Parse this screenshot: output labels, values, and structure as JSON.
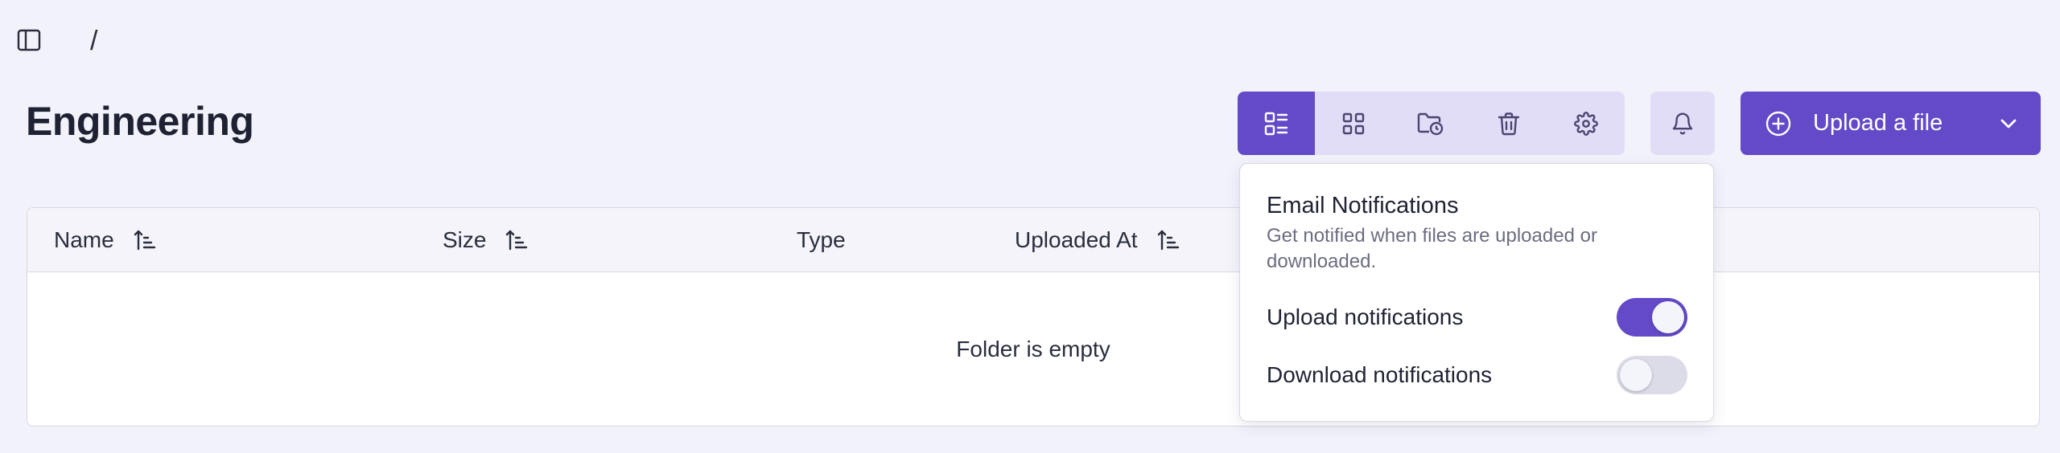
{
  "topbar": {
    "sidebar_toggle_icon": "sidebar-panel-icon",
    "breadcrumb_separator": "/"
  },
  "page": {
    "title": "Engineering"
  },
  "toolbar": {
    "view_buttons": [
      {
        "icon": "list-view-icon",
        "active": true
      },
      {
        "icon": "grid-view-icon",
        "active": false
      },
      {
        "icon": "folder-clock-icon",
        "active": false
      },
      {
        "icon": "trash-icon",
        "active": false
      },
      {
        "icon": "gear-icon",
        "active": false
      }
    ],
    "notifications_icon": "bell-icon",
    "upload": {
      "label": "Upload a file",
      "icon": "plus-circle-icon",
      "caret_icon": "chevron-down-icon"
    }
  },
  "table": {
    "columns": [
      {
        "label": "Name",
        "sortable": true
      },
      {
        "label": "Size",
        "sortable": true
      },
      {
        "label": "Type",
        "sortable": false
      },
      {
        "label": "Uploaded At",
        "sortable": true
      }
    ],
    "empty_message": "Folder is empty"
  },
  "notifications_popover": {
    "title": "Email Notifications",
    "description": "Get notified when files are uploaded or downloaded.",
    "settings": [
      {
        "label": "Upload notifications",
        "enabled": true
      },
      {
        "label": "Download notifications",
        "enabled": false
      }
    ]
  },
  "colors": {
    "accent": "#6449c8",
    "accent_light": "#e2ddf7",
    "background": "#f2f2fb"
  }
}
